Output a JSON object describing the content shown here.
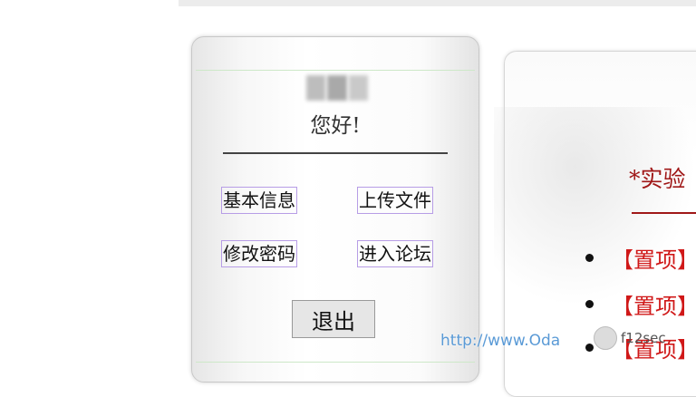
{
  "user_panel": {
    "greeting": "您好!",
    "menu": {
      "basic_info": "基本信息",
      "upload_file": "上传文件",
      "change_password": "修改密码",
      "enter_forum": "进入论坛"
    },
    "logout_label": "退出"
  },
  "content": {
    "title": "*实验",
    "posts": [
      {
        "tag": "【置项】"
      },
      {
        "tag": "【置项】"
      },
      {
        "tag": "【置项】"
      }
    ]
  },
  "watermark": {
    "url": "http://www.Oda",
    "badge": "f12sec"
  },
  "colors": {
    "accent_red": "#a01818",
    "tag_red": "#d01818",
    "menu_border": "#b79de6",
    "watermark_blue": "#5a9ad6"
  }
}
